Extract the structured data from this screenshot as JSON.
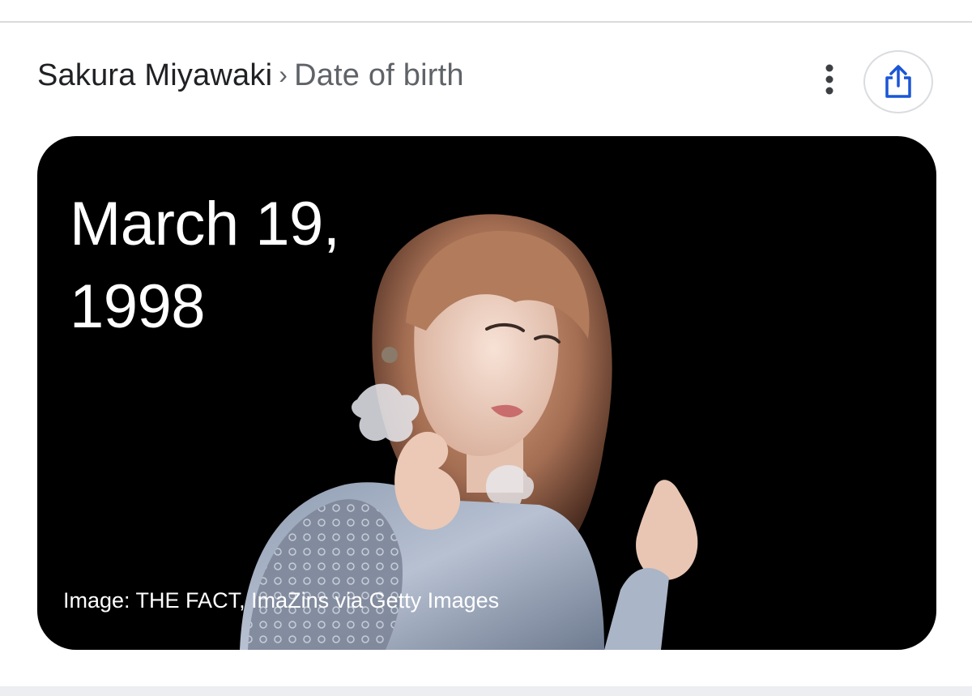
{
  "header": {
    "entity": "Sakura Miyawaki",
    "separator": "›",
    "attribute": "Date of birth"
  },
  "icons": {
    "more": "more-vert-icon",
    "share": "share-icon"
  },
  "answer": {
    "value": "March 19, 1998",
    "caption": "Image: THE FACT, ImaZins via Getty Images"
  },
  "colors": {
    "card_background": "#000000",
    "share_icon": "#1a56d6",
    "divider": "#d9dadd"
  }
}
